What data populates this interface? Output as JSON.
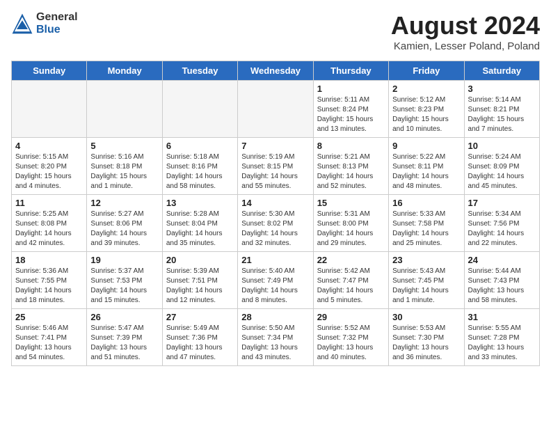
{
  "header": {
    "logo_general": "General",
    "logo_blue": "Blue",
    "title": "August 2024",
    "subtitle": "Kamien, Lesser Poland, Poland"
  },
  "days_of_week": [
    "Sunday",
    "Monday",
    "Tuesday",
    "Wednesday",
    "Thursday",
    "Friday",
    "Saturday"
  ],
  "weeks": [
    [
      {
        "day": "",
        "info": ""
      },
      {
        "day": "",
        "info": ""
      },
      {
        "day": "",
        "info": ""
      },
      {
        "day": "",
        "info": ""
      },
      {
        "day": "1",
        "info": "Sunrise: 5:11 AM\nSunset: 8:24 PM\nDaylight: 15 hours\nand 13 minutes."
      },
      {
        "day": "2",
        "info": "Sunrise: 5:12 AM\nSunset: 8:23 PM\nDaylight: 15 hours\nand 10 minutes."
      },
      {
        "day": "3",
        "info": "Sunrise: 5:14 AM\nSunset: 8:21 PM\nDaylight: 15 hours\nand 7 minutes."
      }
    ],
    [
      {
        "day": "4",
        "info": "Sunrise: 5:15 AM\nSunset: 8:20 PM\nDaylight: 15 hours\nand 4 minutes."
      },
      {
        "day": "5",
        "info": "Sunrise: 5:16 AM\nSunset: 8:18 PM\nDaylight: 15 hours\nand 1 minute."
      },
      {
        "day": "6",
        "info": "Sunrise: 5:18 AM\nSunset: 8:16 PM\nDaylight: 14 hours\nand 58 minutes."
      },
      {
        "day": "7",
        "info": "Sunrise: 5:19 AM\nSunset: 8:15 PM\nDaylight: 14 hours\nand 55 minutes."
      },
      {
        "day": "8",
        "info": "Sunrise: 5:21 AM\nSunset: 8:13 PM\nDaylight: 14 hours\nand 52 minutes."
      },
      {
        "day": "9",
        "info": "Sunrise: 5:22 AM\nSunset: 8:11 PM\nDaylight: 14 hours\nand 48 minutes."
      },
      {
        "day": "10",
        "info": "Sunrise: 5:24 AM\nSunset: 8:09 PM\nDaylight: 14 hours\nand 45 minutes."
      }
    ],
    [
      {
        "day": "11",
        "info": "Sunrise: 5:25 AM\nSunset: 8:08 PM\nDaylight: 14 hours\nand 42 minutes."
      },
      {
        "day": "12",
        "info": "Sunrise: 5:27 AM\nSunset: 8:06 PM\nDaylight: 14 hours\nand 39 minutes."
      },
      {
        "day": "13",
        "info": "Sunrise: 5:28 AM\nSunset: 8:04 PM\nDaylight: 14 hours\nand 35 minutes."
      },
      {
        "day": "14",
        "info": "Sunrise: 5:30 AM\nSunset: 8:02 PM\nDaylight: 14 hours\nand 32 minutes."
      },
      {
        "day": "15",
        "info": "Sunrise: 5:31 AM\nSunset: 8:00 PM\nDaylight: 14 hours\nand 29 minutes."
      },
      {
        "day": "16",
        "info": "Sunrise: 5:33 AM\nSunset: 7:58 PM\nDaylight: 14 hours\nand 25 minutes."
      },
      {
        "day": "17",
        "info": "Sunrise: 5:34 AM\nSunset: 7:56 PM\nDaylight: 14 hours\nand 22 minutes."
      }
    ],
    [
      {
        "day": "18",
        "info": "Sunrise: 5:36 AM\nSunset: 7:55 PM\nDaylight: 14 hours\nand 18 minutes."
      },
      {
        "day": "19",
        "info": "Sunrise: 5:37 AM\nSunset: 7:53 PM\nDaylight: 14 hours\nand 15 minutes."
      },
      {
        "day": "20",
        "info": "Sunrise: 5:39 AM\nSunset: 7:51 PM\nDaylight: 14 hours\nand 12 minutes."
      },
      {
        "day": "21",
        "info": "Sunrise: 5:40 AM\nSunset: 7:49 PM\nDaylight: 14 hours\nand 8 minutes."
      },
      {
        "day": "22",
        "info": "Sunrise: 5:42 AM\nSunset: 7:47 PM\nDaylight: 14 hours\nand 5 minutes."
      },
      {
        "day": "23",
        "info": "Sunrise: 5:43 AM\nSunset: 7:45 PM\nDaylight: 14 hours\nand 1 minute."
      },
      {
        "day": "24",
        "info": "Sunrise: 5:44 AM\nSunset: 7:43 PM\nDaylight: 13 hours\nand 58 minutes."
      }
    ],
    [
      {
        "day": "25",
        "info": "Sunrise: 5:46 AM\nSunset: 7:41 PM\nDaylight: 13 hours\nand 54 minutes."
      },
      {
        "day": "26",
        "info": "Sunrise: 5:47 AM\nSunset: 7:39 PM\nDaylight: 13 hours\nand 51 minutes."
      },
      {
        "day": "27",
        "info": "Sunrise: 5:49 AM\nSunset: 7:36 PM\nDaylight: 13 hours\nand 47 minutes."
      },
      {
        "day": "28",
        "info": "Sunrise: 5:50 AM\nSunset: 7:34 PM\nDaylight: 13 hours\nand 43 minutes."
      },
      {
        "day": "29",
        "info": "Sunrise: 5:52 AM\nSunset: 7:32 PM\nDaylight: 13 hours\nand 40 minutes."
      },
      {
        "day": "30",
        "info": "Sunrise: 5:53 AM\nSunset: 7:30 PM\nDaylight: 13 hours\nand 36 minutes."
      },
      {
        "day": "31",
        "info": "Sunrise: 5:55 AM\nSunset: 7:28 PM\nDaylight: 13 hours\nand 33 minutes."
      }
    ]
  ]
}
